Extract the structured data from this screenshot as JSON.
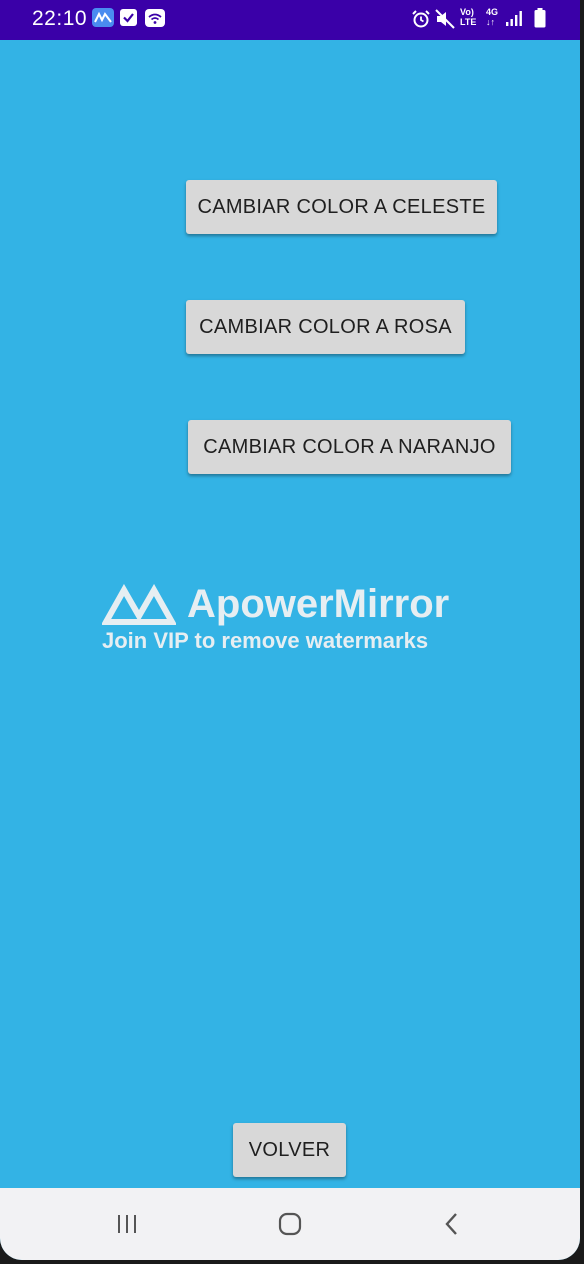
{
  "status_bar": {
    "time": "22:10",
    "volte_label_top": "Vo)",
    "volte_label_bottom": "LTE",
    "network_label": "4G",
    "icons": [
      "apowermirror-icon",
      "checkbox-app-icon",
      "wifi-app-icon",
      "alarm-icon",
      "mute-icon",
      "signal-icon",
      "battery-icon"
    ]
  },
  "buttons": {
    "celeste": "CAMBIAR COLOR A CELESTE",
    "rosa": "CAMBIAR COLOR A ROSA",
    "naranjo": "CAMBIAR COLOR A NARANJO",
    "volver": "VOLVER"
  },
  "watermark": {
    "title": "ApowerMirror",
    "subtitle": "Join VIP to remove watermarks"
  },
  "nav_bar": {
    "icons": [
      "recent-apps-icon",
      "home-icon",
      "back-icon"
    ]
  },
  "colors": {
    "background": "#33b3e5",
    "status_bar": "#3a00a8",
    "button": "#d8d8d8",
    "nav_bar": "#f2f2f4"
  }
}
